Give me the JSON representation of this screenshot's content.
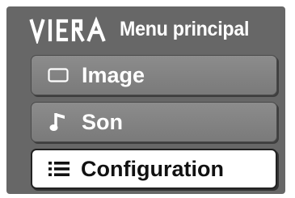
{
  "header": {
    "brand": "VIERA",
    "title": "Menu principal"
  },
  "menu": {
    "items": [
      {
        "label": "Image",
        "icon": "picture-icon",
        "selected": false
      },
      {
        "label": "Son",
        "icon": "music-note-icon",
        "selected": false
      },
      {
        "label": "Configuration",
        "icon": "list-icon",
        "selected": true
      }
    ]
  },
  "colors": {
    "panel_background": "#676767",
    "inactive_item": "#828282",
    "active_item": "#ffffff",
    "text_light": "#ffffff",
    "text_dark": "#111111"
  }
}
